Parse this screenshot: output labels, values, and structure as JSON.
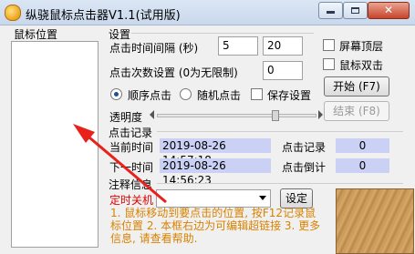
{
  "window": {
    "title": "纵骁鼠标点击器V1.1(试用版)",
    "minimize": "",
    "maximize": "",
    "close": "✕"
  },
  "positions": {
    "header": "鼠标位置",
    "items": []
  },
  "settings": {
    "title": "设置",
    "interval_label": "点击时间间隔 (秒)",
    "interval_value1": "5",
    "interval_value2": "20",
    "count_label": "点击次数设置 (0为无限制)",
    "count_value": "0",
    "mode_sequential": "顺序点击",
    "mode_random": "随机点击",
    "mode_selected": "sequential",
    "save_settings": "保存设置",
    "opacity_label": "透明度",
    "opacity_value": 0.72,
    "topmost": "屏幕顶层",
    "double_click": "鼠标双击",
    "start_button": "开始 (F7)",
    "stop_button": "结束 (F8)"
  },
  "record": {
    "title": "点击记录",
    "current_time_label": "当前时间",
    "current_time_value": "2019-08-26 14:57:18",
    "click_record_label": "点击记录",
    "click_record_value": "0",
    "next_time_label": "下一时间",
    "next_time_value": "2019-08-26 14:56:23",
    "countdown_label": "点击倒计",
    "countdown_value": "0"
  },
  "notes": {
    "title": "注释信息",
    "shutdown_label": "定时关机",
    "settings_button": "设定",
    "text": "1. 鼠标移动到要点击的位置, 按F12记录鼠标位置  2. 本框右边为可编辑超链接  3. 更多信息, 请查看帮助."
  },
  "colors": {
    "value_bg": "#cbd0f5",
    "note_text": "#d98200",
    "shutdown_text": "#e00000",
    "annotation_arrow": "#e8211b"
  }
}
